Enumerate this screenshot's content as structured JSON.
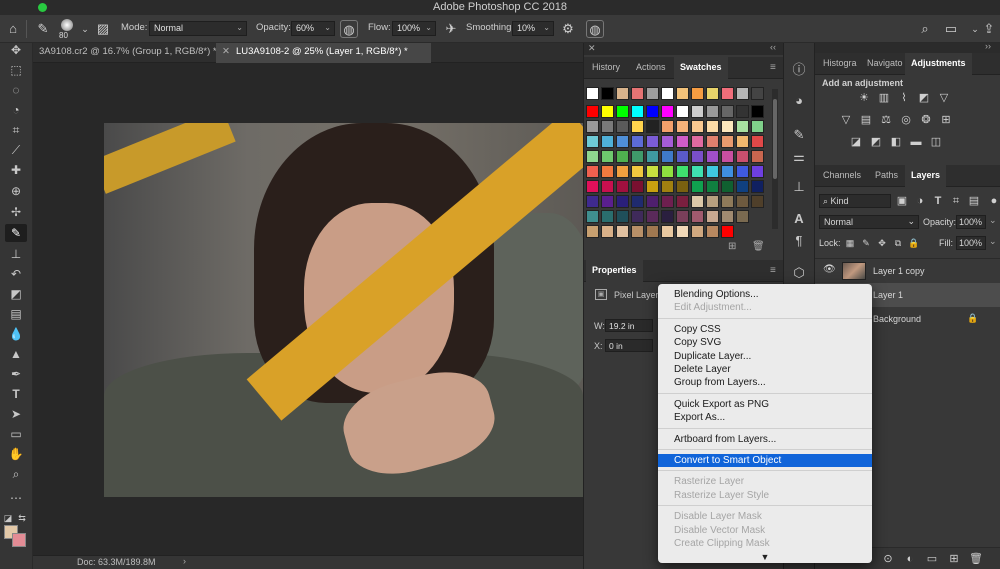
{
  "app": {
    "title": "Adobe Photoshop CC 2018"
  },
  "options_bar": {
    "brush_size": "80",
    "mode_label": "Mode:",
    "mode_value": "Normal",
    "opacity_label": "Opacity:",
    "opacity_value": "60%",
    "flow_label": "Flow:",
    "flow_value": "100%",
    "smoothing_label": "Smoothing:",
    "smoothing_value": "10%"
  },
  "documents": [
    {
      "label": "3A9108.cr2 @ 16.7% (Group 1, RGB/8*) *",
      "active": false
    },
    {
      "label": "LU3A9108-2 @ 25% (Layer 1, RGB/8*) *",
      "active": true
    }
  ],
  "status": {
    "doc": "Doc: 63.3M/189.8M"
  },
  "swatch_panel": {
    "tabs": [
      "History",
      "Actions",
      "Swatches"
    ],
    "active_tab": "Swatches",
    "colors": [
      [
        "#ffffff",
        "#000000",
        "#d8b38c",
        "#e57373",
        "#9e9e9e",
        "#ffffff",
        "#f2c27a",
        "#f59c42",
        "#e8d36a",
        "#f06d7a",
        "#b5b5b5",
        "#444444"
      ],
      [
        "#ff0000",
        "#ffff00",
        "#00ff00",
        "#00ffff",
        "#0000ff",
        "#ff00ff",
        "#ffffff",
        "#cccccc",
        "#999999",
        "#666666",
        "#333333",
        "#000000"
      ],
      [
        "#9a9a9a",
        "#7a7a7a",
        "#5a5a5a",
        "#ffd34d",
        "#222222",
        "#f4a06b",
        "#f7b27a",
        "#f9c890",
        "#fbdaa6",
        "#fce7bd",
        "#a8e0a0",
        "#7fd08a"
      ],
      [
        "#6ecad6",
        "#4fb0d8",
        "#4f8fd8",
        "#5c6bd6",
        "#7b5cd6",
        "#a55cd6",
        "#cf5cc8",
        "#e06aa0",
        "#e0806e",
        "#e89a6e",
        "#f0b86e",
        "#e04848"
      ],
      [
        "#8fd68f",
        "#6ec86e",
        "#4fb04f",
        "#3f9a6a",
        "#3f9aa0",
        "#3f7ac8",
        "#5a5ac8",
        "#7a4fc8",
        "#a04fc8",
        "#c84fa0",
        "#c84f6e",
        "#c8664f"
      ],
      [
        "#f0604f",
        "#f07a3f",
        "#f0a03f",
        "#f0c83f",
        "#c8e03f",
        "#8fe03f",
        "#3fe06e",
        "#3fe0b0",
        "#3fc8e0",
        "#3f8fe0",
        "#3f5ae0",
        "#6e3fe0"
      ],
      [
        "#e0105a",
        "#c8104f",
        "#a0103f",
        "#7a1030",
        "#c8a010",
        "#a08010",
        "#7a6010",
        "#10a04f",
        "#108040",
        "#106030",
        "#104080",
        "#102060"
      ],
      [
        "#3f2a8f",
        "#5a1f8f",
        "#2a1f7a",
        "#1f2a6e",
        "#4f1f6e",
        "#6e1f4f",
        "#7a1f3f",
        "#dcc8a8",
        "#b8a080",
        "#8f7a5a",
        "#6e5a3f",
        "#4f3f2a"
      ],
      [
        "#3f8f8f",
        "#2a6e6e",
        "#1f4f5a",
        "#3f2a5a",
        "#5a2a5a",
        "#2a1f3f",
        "#7a3f5a",
        "#a05a6e",
        "#c8a890",
        "#a08a70",
        "#7a6a50",
        ""
      ],
      [
        "#c8a070",
        "#d8b088",
        "#e0c0a0",
        "#b89068",
        "#a07850",
        "#e8c8a0",
        "#f0d8b8",
        "#d0a880",
        "#b88860",
        "#ff0000",
        "",
        ""
      ]
    ]
  },
  "properties_panel": {
    "title": "Properties",
    "kind": "Pixel Layer",
    "w_label": "W:",
    "w_value": "19.2 in",
    "x_label": "X:",
    "x_value": "0 in"
  },
  "right_panel": {
    "top_tabs": [
      "Histogra",
      "Navigato",
      "Adjustments"
    ],
    "active_top_tab": "Adjustments",
    "add_adjustment": "Add an adjustment",
    "adjust_icons": [
      [
        "sun-icon",
        "levels-icon",
        "curves-icon",
        "exposure-icon",
        "triangle-icon"
      ],
      [
        "vibrance-icon",
        "hue-icon",
        "balance-icon",
        "photo-filter-icon",
        "mixer-icon",
        "lookup-icon"
      ],
      [
        "invert-icon",
        "posterize-icon",
        "threshold-icon",
        "gradient-map-icon",
        "selective-color-icon"
      ]
    ],
    "layer_tabs": [
      "Channels",
      "Paths",
      "Layers"
    ],
    "active_layer_tab": "Layers",
    "filter_kind": "Kind",
    "blend_mode": "Normal",
    "opacity_label": "Opacity:",
    "opacity_value": "100%",
    "lock_label": "Lock:",
    "fill_label": "Fill:",
    "fill_value": "100%",
    "layers": [
      {
        "name": "Layer 1 copy",
        "visible": true,
        "selected": false,
        "locked": false
      },
      {
        "name": "Layer 1",
        "visible": false,
        "selected": true,
        "locked": false
      },
      {
        "name": "Background",
        "visible": false,
        "selected": false,
        "locked": true
      }
    ]
  },
  "context_menu": {
    "items": [
      {
        "label": "Blending Options...",
        "state": "enabled"
      },
      {
        "label": "Edit Adjustment...",
        "state": "disabled"
      },
      {
        "sep": true
      },
      {
        "label": "Copy CSS",
        "state": "enabled"
      },
      {
        "label": "Copy SVG",
        "state": "enabled"
      },
      {
        "label": "Duplicate Layer...",
        "state": "enabled"
      },
      {
        "label": "Delete Layer",
        "state": "enabled"
      },
      {
        "label": "Group from Layers...",
        "state": "enabled"
      },
      {
        "sep": true
      },
      {
        "label": "Quick Export as PNG",
        "state": "enabled"
      },
      {
        "label": "Export As...",
        "state": "enabled"
      },
      {
        "sep": true
      },
      {
        "label": "Artboard from Layers...",
        "state": "enabled"
      },
      {
        "sep": true
      },
      {
        "label": "Convert to Smart Object",
        "state": "highlight"
      },
      {
        "sep": true
      },
      {
        "label": "Rasterize Layer",
        "state": "disabled"
      },
      {
        "label": "Rasterize Layer Style",
        "state": "disabled"
      },
      {
        "sep": true
      },
      {
        "label": "Disable Layer Mask",
        "state": "disabled"
      },
      {
        "label": "Disable Vector Mask",
        "state": "disabled"
      },
      {
        "label": "Create Clipping Mask",
        "state": "disabled"
      }
    ]
  }
}
